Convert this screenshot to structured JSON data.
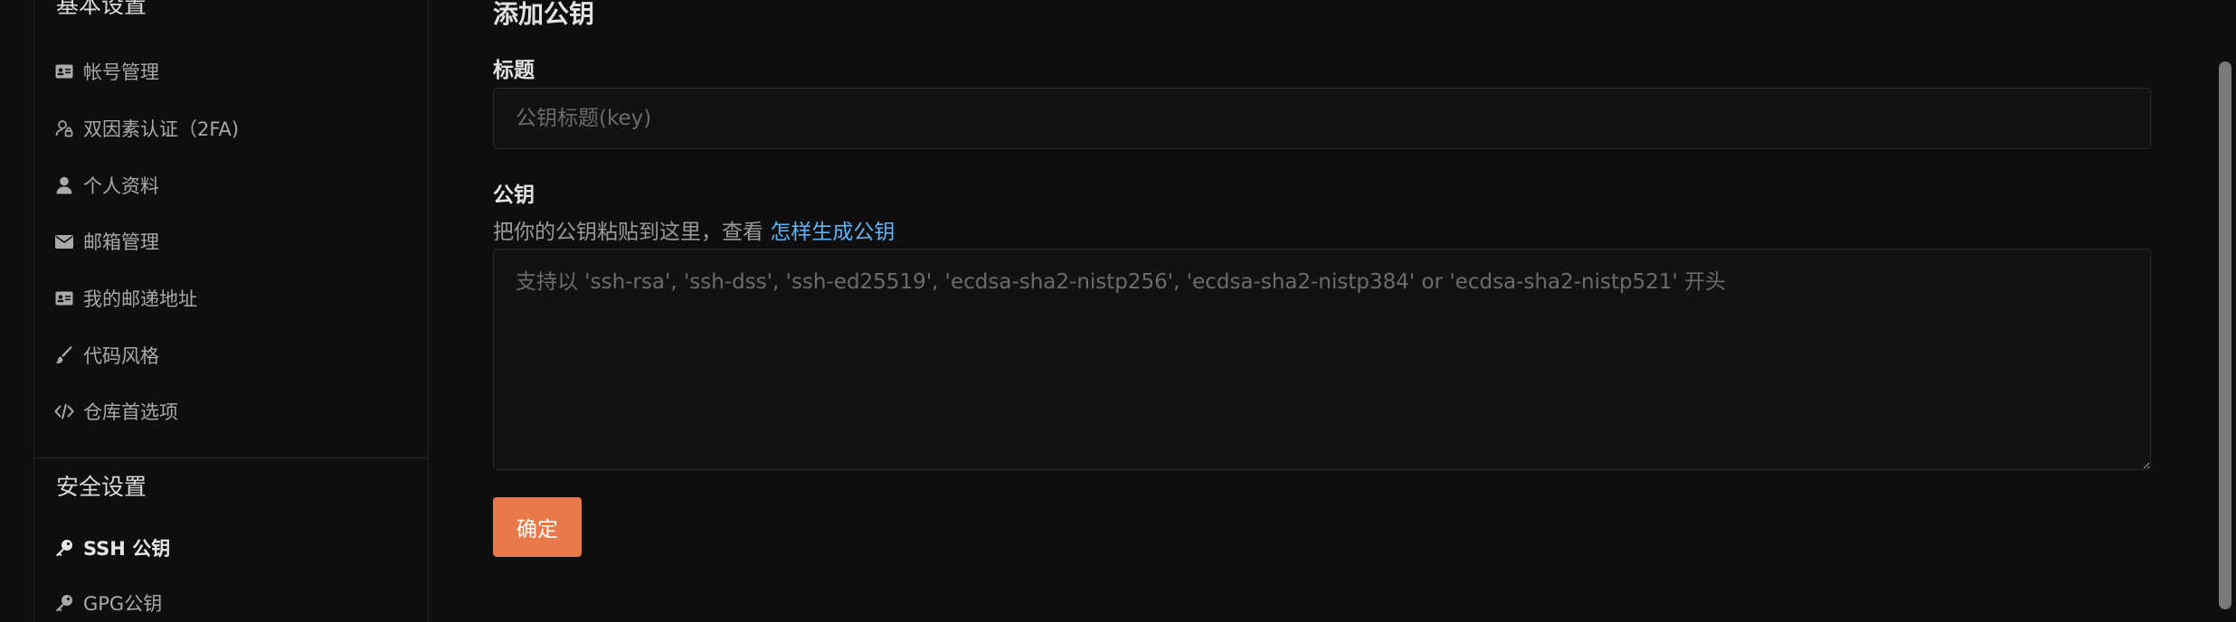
{
  "sidebar": {
    "sections": [
      {
        "title": "基本设置",
        "items": [
          {
            "label": "帐号管理",
            "icon": "id-card-icon"
          },
          {
            "label": "双因素认证（2FA)",
            "icon": "user-lock-icon"
          },
          {
            "label": "个人资料",
            "icon": "user-icon"
          },
          {
            "label": "邮箱管理",
            "icon": "envelope-icon"
          },
          {
            "label": "我的邮递地址",
            "icon": "address-card-icon"
          },
          {
            "label": "代码风格",
            "icon": "brush-icon"
          },
          {
            "label": "仓库首选项",
            "icon": "code-icon"
          }
        ]
      },
      {
        "title": "安全设置",
        "items": [
          {
            "label": "SSH 公钥",
            "icon": "key-icon",
            "active": true
          },
          {
            "label": "GPG公钥",
            "icon": "key-icon"
          }
        ]
      }
    ]
  },
  "form": {
    "heading": "添加公钥",
    "title_label": "标题",
    "title_placeholder": "公钥标题(key)",
    "title_value": "",
    "key_label": "公钥",
    "key_help_prefix": "把你的公钥粘贴到这里，查看 ",
    "key_help_link": "怎样生成公钥",
    "key_placeholder": "支持以 'ssh-rsa', 'ssh-dss', 'ssh-ed25519', 'ecdsa-sha2-nistp256', 'ecdsa-sha2-nistp384' or 'ecdsa-sha2-nistp521' 开头",
    "key_value": "",
    "submit_label": "确定"
  },
  "colors": {
    "background": "#0e0e0e",
    "accent_button": "#e8794b",
    "link": "#5fb3f5"
  }
}
